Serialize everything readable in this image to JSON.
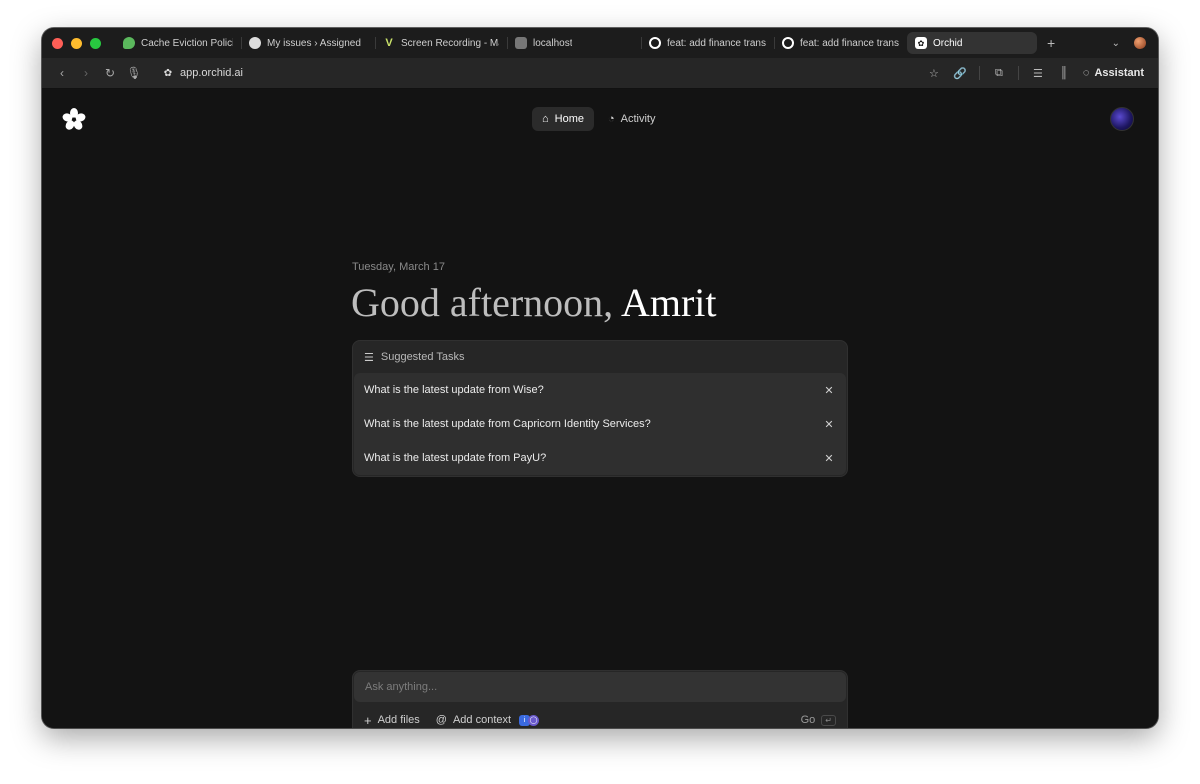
{
  "tabs": [
    {
      "label": "Cache Eviction Policies",
      "icon": "evernote-icon",
      "color": "#5bb85d"
    },
    {
      "label": "My issues › Assigned",
      "icon": "linear-icon",
      "color": "#dddddd"
    },
    {
      "label": "Screen Recording - Mar",
      "icon": "vimeo-icon",
      "color": "#c9e26a"
    },
    {
      "label": "localhost",
      "icon": "globe-icon",
      "color": "#888888"
    },
    {
      "label": "feat: add finance transa",
      "icon": "github-icon",
      "color": "#ffffff"
    },
    {
      "label": "feat: add finance transa",
      "icon": "github-icon",
      "color": "#ffffff"
    },
    {
      "label": "Orchid",
      "icon": "orchid-icon",
      "color": "#ffffff",
      "active": true
    }
  ],
  "address": {
    "url": "app.orchid.ai",
    "assistant_label": "Assistant"
  },
  "nav": {
    "home_label": "Home",
    "activity_label": "Activity"
  },
  "main": {
    "date": "Tuesday, March 17",
    "greeting": "Good afternoon,",
    "user_name": "Amrit"
  },
  "suggested": {
    "title": "Suggested Tasks",
    "tasks": [
      "What is the latest update from Wise?",
      "What is the latest update from Capricorn Identity Services?",
      "What is the latest update from PayU?"
    ]
  },
  "composer": {
    "placeholder": "Ask anything...",
    "add_files_label": "Add files",
    "add_context_label": "Add context",
    "go_label": "Go",
    "enter_symbol": "↵"
  },
  "colors": {
    "window_bg": "#131313",
    "tab_strip": "#1c1c1c",
    "card_bg": "#262626"
  }
}
